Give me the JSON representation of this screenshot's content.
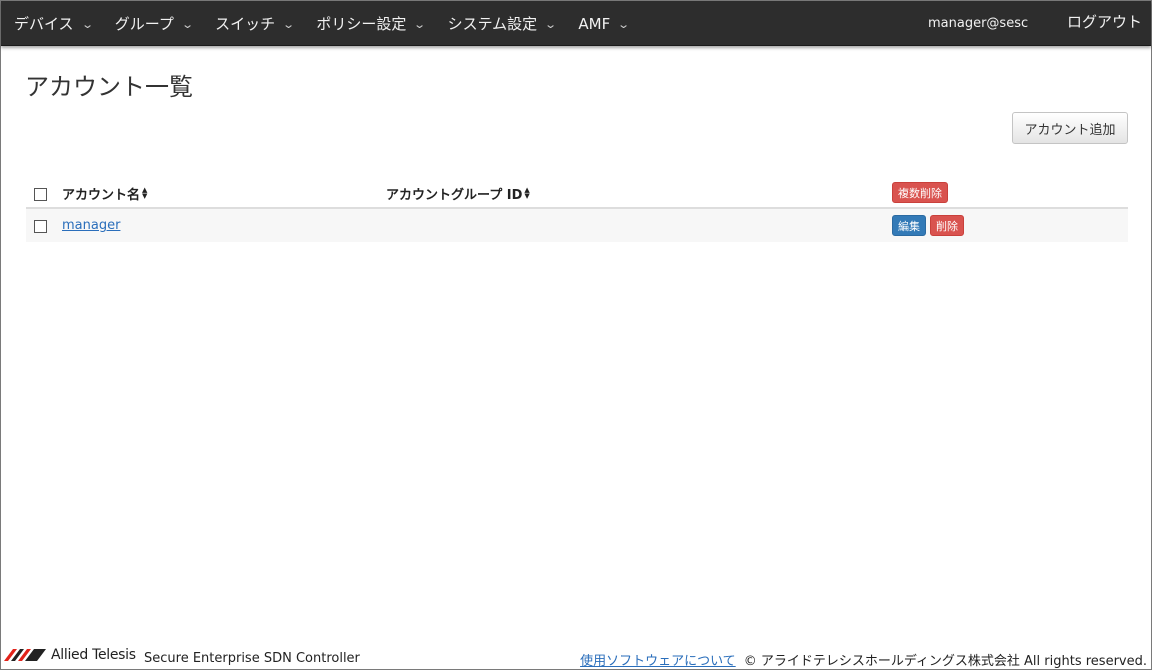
{
  "nav": {
    "items": [
      {
        "label": "デバイス"
      },
      {
        "label": "グループ"
      },
      {
        "label": "スイッチ"
      },
      {
        "label": "ポリシー設定"
      },
      {
        "label": "システム設定"
      },
      {
        "label": "AMF"
      }
    ],
    "chevron": "⌄",
    "user": "manager@sesc",
    "logout": "ログアウト"
  },
  "page": {
    "title": "アカウント一覧",
    "add_button": "アカウント追加"
  },
  "table": {
    "columns": [
      {
        "label": "アカウント名"
      },
      {
        "label": "アカウントグループ ID"
      }
    ],
    "bulk_delete": "複数削除",
    "rows": [
      {
        "name": "manager",
        "group_id": "",
        "edit": "編集",
        "delete": "削除"
      }
    ]
  },
  "footer": {
    "brand": "Allied Telesis",
    "product": "Secure Enterprise SDN Controller",
    "software_link": "使用ソフトウェアについて",
    "copyright": "© アライドテレシスホールディングス株式会社 All rights reserved."
  },
  "colors": {
    "navbar": "#2d2d2d",
    "danger": "#d9534f",
    "primary": "#337ab7",
    "link": "#2a6ebb",
    "logo_red": "#e2231a"
  }
}
